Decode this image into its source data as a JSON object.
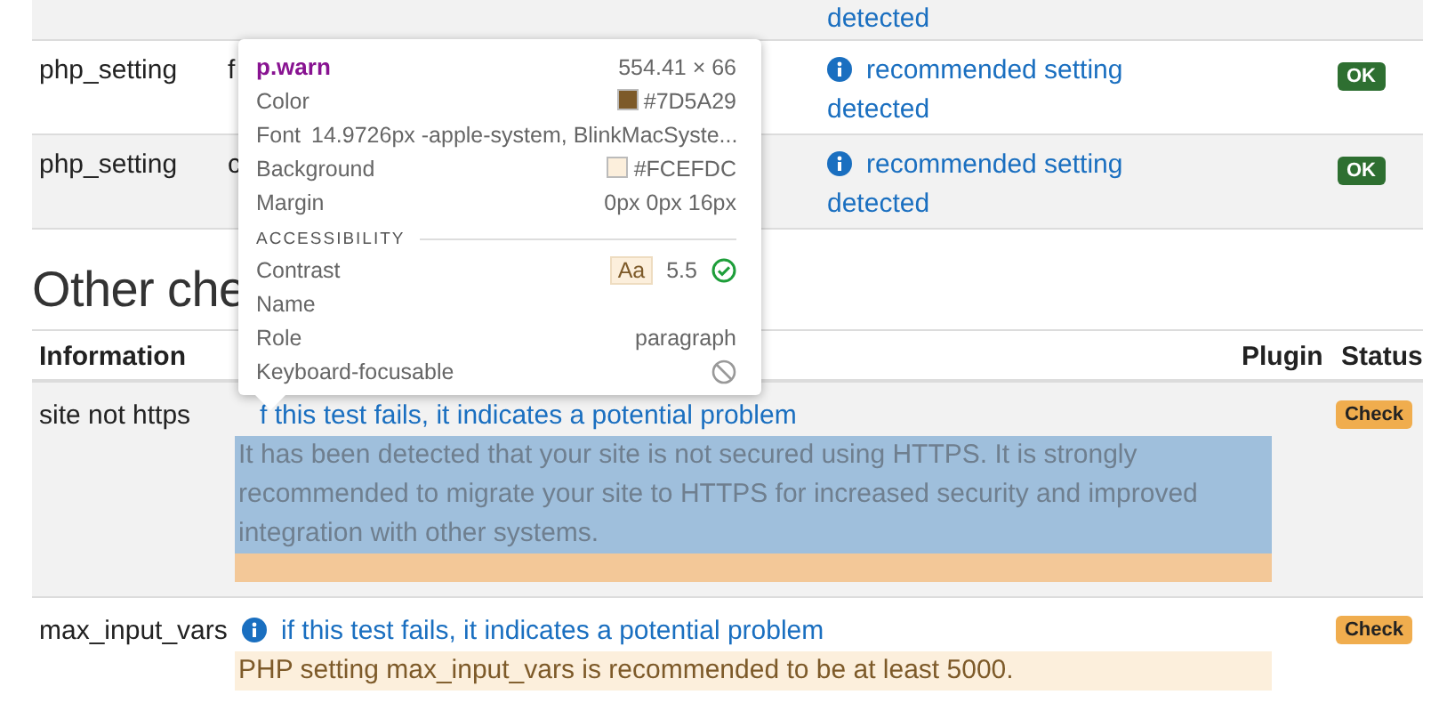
{
  "top_table": {
    "rows": [
      {
        "kind": "tail",
        "info": "detected"
      },
      {
        "kind": "full",
        "name": "php_setting",
        "value": "f",
        "info": "recommended setting detected",
        "status": "OK",
        "color": "#2e6f31"
      },
      {
        "kind": "full",
        "name": "php_setting",
        "value": "c",
        "info": "recommended setting detected",
        "status": "OK",
        "color": "#2e6f31"
      }
    ]
  },
  "section": {
    "heading": "Other che",
    "columns": [
      "Information",
      "Plugin",
      "Status"
    ],
    "rows": [
      {
        "name": "site not https",
        "note": "f this test fails, it indicates a potential problem",
        "note_icon": false,
        "warning": "It has been detected that your site is not secured using HTTPS. It is strongly recommended to migrate your site to HTTPS for increased security and improved integration with other systems.",
        "highlighted": true,
        "status": "Check",
        "color": "#f0ad4e"
      },
      {
        "name": "max_input_vars",
        "note": "if this test fails, it indicates a potential problem",
        "note_icon": true,
        "warning": "PHP setting max_input_vars is recommended to be at least 5000.",
        "highlighted": false,
        "status": "Check",
        "color": "#f0ad4e"
      }
    ]
  },
  "inspector": {
    "selector": "p.warn",
    "size": "554.41 × 66",
    "properties": [
      {
        "label": "Color",
        "value": "#7D5A29",
        "color": "#7d5a29"
      },
      {
        "label": "Font",
        "value": "14.9726px -apple-system, BlinkMacSyste..."
      },
      {
        "label": "Background",
        "value": "#FCEFDC",
        "color": "#fcefdc"
      },
      {
        "label": "Margin",
        "value": "0px 0px 16px"
      }
    ],
    "section": "ACCESSIBILITY",
    "accessibility": [
      {
        "label": "Contrast",
        "kind": "contrast",
        "sample": "Aa",
        "value": "5.5"
      },
      {
        "label": "Name",
        "kind": "empty"
      },
      {
        "label": "Role",
        "kind": "text",
        "value": "paragraph"
      },
      {
        "label": "Keyboard-focusable",
        "kind": "blocked"
      }
    ]
  }
}
